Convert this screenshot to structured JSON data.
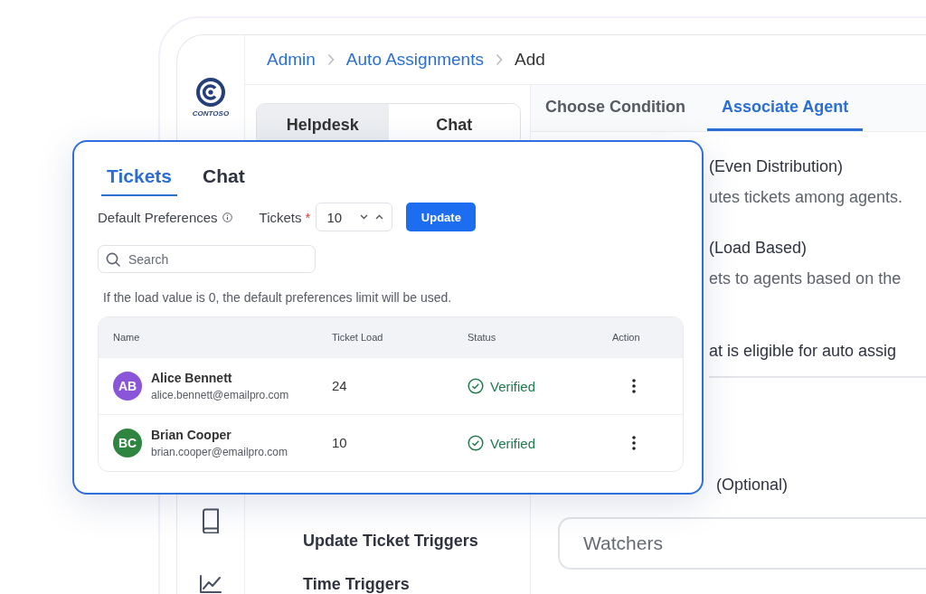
{
  "breadcrumb": [
    {
      "label": "Admin",
      "link": true
    },
    {
      "label": "Auto Assignments",
      "link": true
    },
    {
      "label": "Add",
      "link": false
    }
  ],
  "logo": {
    "text": "CONTOSO"
  },
  "channel_toggle": [
    {
      "label": "Helpdesk",
      "selected": true
    },
    {
      "label": "Chat",
      "selected": false
    }
  ],
  "trigger_items": [
    "Update Ticket Triggers",
    "Time Triggers"
  ],
  "step_tabs": [
    {
      "label": "Choose Condition",
      "selected": false
    },
    {
      "label": "Associate Agent",
      "selected": true
    }
  ],
  "options": [
    {
      "title": "(Even Distribution)",
      "description": "utes tickets among agents."
    },
    {
      "title": "(Load Based)",
      "description": "ets to agents based on the"
    }
  ],
  "eligibility_label": "at is eligible for auto assig",
  "watchers": {
    "label": "(Optional)",
    "placeholder": "Watchers"
  },
  "preferences_card": {
    "tabs": [
      {
        "label": "Tickets",
        "selected": true
      },
      {
        "label": "Chat",
        "selected": false
      }
    ],
    "default_label": "Default Preferences",
    "tickets_label": "Tickets",
    "required": true,
    "required_mark": "*",
    "tickets_value": "10",
    "update_button": "Update",
    "search_placeholder": "Search",
    "note": "If the load value is 0, the default preferences limit will be used.",
    "table": {
      "columns": [
        "Name",
        "Ticket Load",
        "Status",
        "Action"
      ],
      "rows": [
        {
          "initials": "AB",
          "color": "#8b55d9",
          "name": "Alice Bennett",
          "email": "alice.bennett@emailpro.com",
          "ticket_load": "24",
          "status": "Verified"
        },
        {
          "initials": "BC",
          "color": "#2e8540",
          "name": "Brian Cooper",
          "email": "brian.cooper@emailpro.com",
          "ticket_load": "10",
          "status": "Verified"
        }
      ]
    }
  }
}
